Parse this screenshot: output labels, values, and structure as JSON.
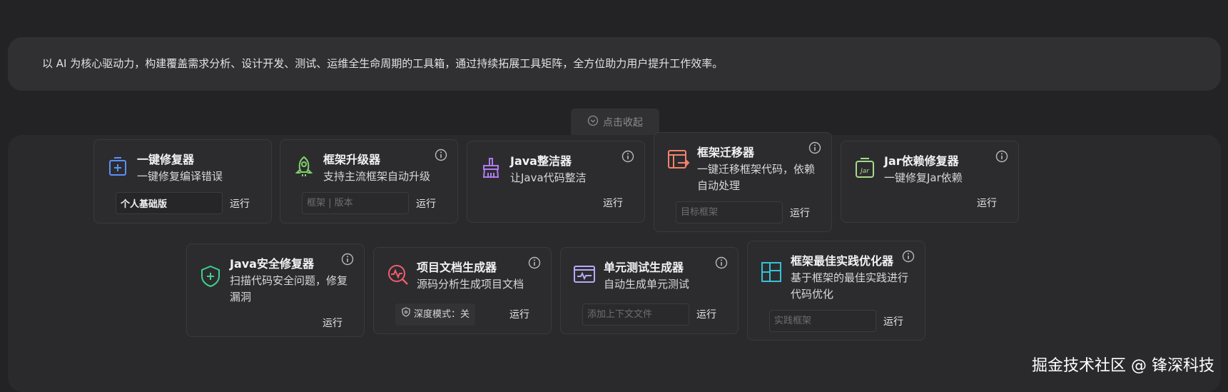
{
  "intro": {
    "text": "以 AI 为核心驱动力，构建覆盖需求分析、设计开发、测试、运维全生命周期的工具箱，通过持续拓展工具矩阵，全方位助力用户提升工作效率。"
  },
  "collapse": {
    "label": "点击收起",
    "icon": "circle-chevron-down-icon"
  },
  "cards": [
    {
      "title": "一键修复器",
      "desc": "一键修复编译错误",
      "field_value": "个人基础版",
      "run_label": "运行",
      "icon": "repair-box-icon",
      "icon_color": "#5b8ff9"
    },
    {
      "title": "框架升级器",
      "desc": "支持主流框架自动升级",
      "field_placeholder": "框架 | 版本",
      "run_label": "运行",
      "icon": "rocket-icon",
      "icon_color": "#7fd36a"
    },
    {
      "title": "Java整洁器",
      "desc": "让Java代码整洁",
      "run_label": "运行",
      "icon": "broom-icon",
      "icon_color": "#b07cf0"
    },
    {
      "title": "框架迁移器",
      "desc": "一键迁移框架代码，依赖自动处理",
      "field_placeholder": "目标框架",
      "run_label": "运行",
      "icon": "migrate-icon",
      "icon_color": "#f2836b"
    },
    {
      "title": "Jar依赖修复器",
      "desc": "一键修复Jar依赖",
      "run_label": "运行",
      "icon": "jar-icon",
      "icon_color": "#a8d98a"
    },
    {
      "title": "Java安全修复器",
      "desc": "扫描代码安全问题，修复漏洞",
      "run_label": "运行",
      "icon": "shield-plus-icon",
      "icon_color": "#3fcf8e"
    },
    {
      "title": "项目文档生成器",
      "desc": "源码分析生成项目文档",
      "mode_label": "深度模式：关",
      "run_label": "运行",
      "icon": "doc-search-icon",
      "icon_color": "#f25c6b"
    },
    {
      "title": "单元测试生成器",
      "desc": "自动生成单元测试",
      "field_placeholder": "添加上下文文件",
      "run_label": "运行",
      "icon": "test-window-icon",
      "icon_color": "#b9a8f5"
    },
    {
      "title": "框架最佳实践优化器",
      "desc": "基于框架的最佳实践进行代码优化",
      "field_placeholder": "实践框架",
      "run_label": "运行",
      "icon": "layout-grid-icon",
      "icon_color": "#33c3d6"
    }
  ],
  "info_icon": "info-icon",
  "watermark": "掘金技术社区 @ 锋深科技"
}
